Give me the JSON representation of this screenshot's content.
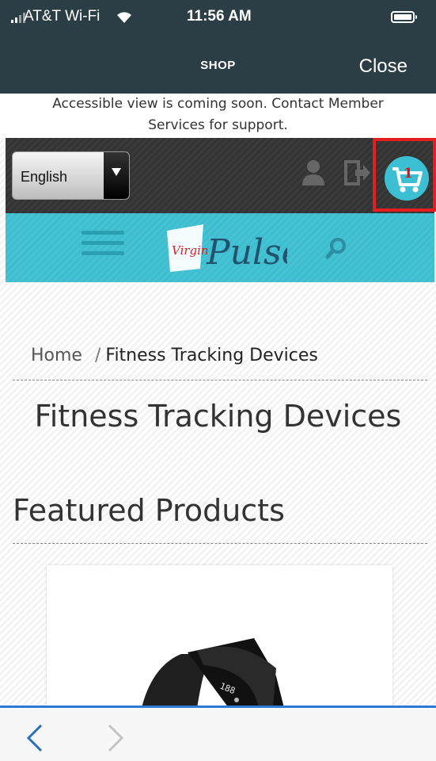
{
  "status_bar": {
    "carrier": "AT&T Wi-Fi",
    "time": "11:56 AM",
    "icons": [
      "signal-icon",
      "wifi-icon",
      "battery-icon"
    ]
  },
  "nav": {
    "title": "SHOP",
    "close_label": "Close"
  },
  "notice": {
    "line1": "Accessible view is coming soon. Contact Member",
    "line2": "Services for support."
  },
  "header": {
    "language": "English",
    "cart_count": "1",
    "icons": [
      "user-icon",
      "logout-icon",
      "cart-icon"
    ]
  },
  "brand": {
    "logo_word_small": "Virgin",
    "logo_word": "Pulse",
    "icons": [
      "menu-icon",
      "search-icon"
    ]
  },
  "breadcrumb": {
    "home": "Home",
    "separator": "/",
    "current": "Fitness Tracking Devices"
  },
  "page": {
    "title": "Fitness Tracking Devices",
    "section_title": "Featured Products"
  },
  "product": {
    "display_text": "188"
  },
  "toolbar": {
    "icons": [
      "back-icon",
      "forward-icon"
    ]
  },
  "colors": {
    "status_bg": "#2c3e45",
    "accent_teal": "#45c2d3",
    "highlight_red": "#e41e1e",
    "toolbar_blue": "#2a7bd6"
  }
}
